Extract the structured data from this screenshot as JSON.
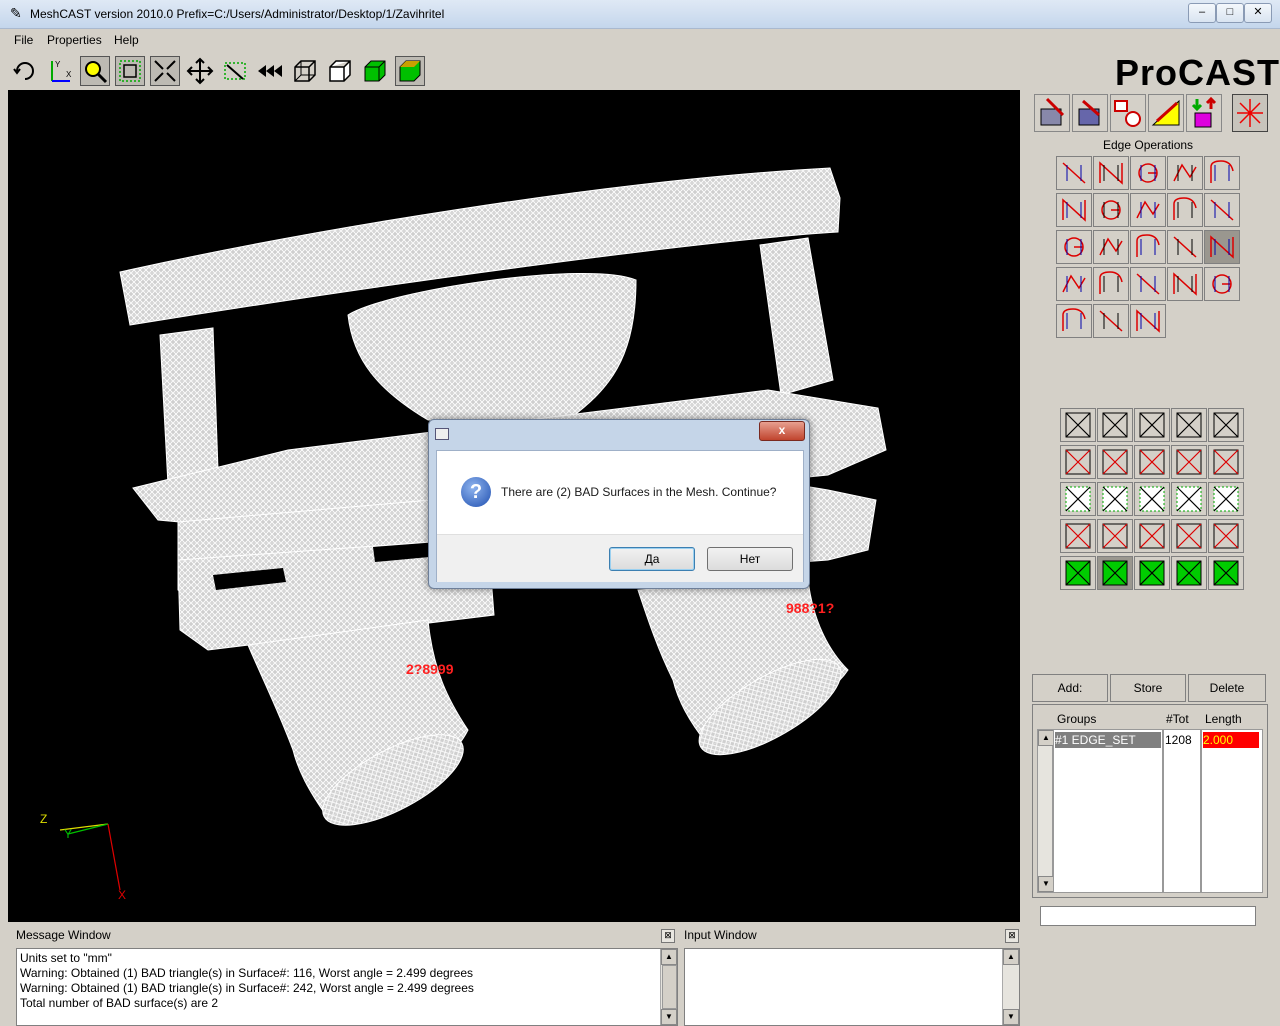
{
  "window": {
    "title": "MeshCAST version 2010.0    Prefix=C:/Users/Administrator/Desktop/1/Zavihritel",
    "minimize": "–",
    "maximize": "□",
    "close": "✕"
  },
  "menu": {
    "file": "File",
    "properties": "Properties",
    "help": "Help"
  },
  "logo": "ProCAST",
  "viewport": {
    "label_left": "2?8999",
    "label_right": "988?1?",
    "axis_z": "Z",
    "axis_y": "Y",
    "axis_x": "X"
  },
  "rightpanel": {
    "section_title": "Edge Operations",
    "add_label": "Add:",
    "store_label": "Store",
    "delete_label": "Delete",
    "col_groups": "Groups",
    "col_tot": "#Tot",
    "col_length": "Length",
    "group_row": {
      "group": "#1  EDGE_SET",
      "tot": "1208",
      "length": "2.000"
    },
    "colors": {
      "length_bg": "#ff0000",
      "length_fg": "#ffff00",
      "group_bg": "#808080"
    }
  },
  "dialog": {
    "message": "There are (2) BAD Surfaces in the Mesh. Continue?",
    "yes_label": "Да",
    "no_label": "Нет",
    "close_label": "x"
  },
  "message_window": {
    "title": "Message Window",
    "close": "⊠",
    "lines": [
      "Units set to \"mm\"",
      "Warning: Obtained (1) BAD triangle(s) in Surface#: 116, Worst angle = 2.499 degrees",
      "Warning: Obtained (1) BAD triangle(s) in Surface#: 242, Worst angle = 2.499 degrees",
      "Total number of BAD surface(s) are 2"
    ]
  },
  "input_window": {
    "title": "Input Window",
    "close": "⊠"
  }
}
